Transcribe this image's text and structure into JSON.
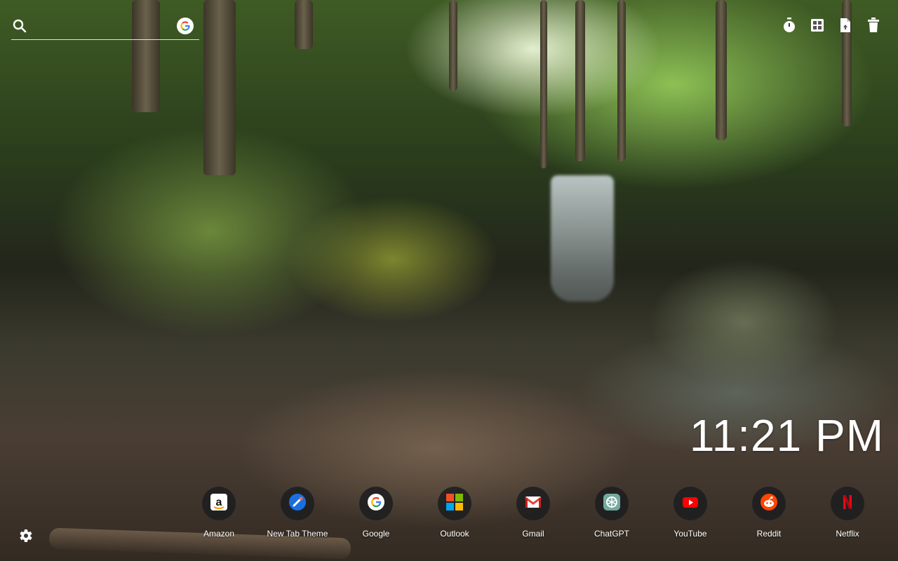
{
  "search": {
    "placeholder": "",
    "icon": "search-icon",
    "engine_icon": "google-icon"
  },
  "toolbar": {
    "items": [
      {
        "icon": "timer-icon"
      },
      {
        "icon": "grid-widget-icon"
      },
      {
        "icon": "file-icon"
      },
      {
        "icon": "trash-icon"
      }
    ]
  },
  "clock": {
    "time": "11:21 PM"
  },
  "shortcuts": [
    {
      "label": "Amazon",
      "icon": "amazon-icon"
    },
    {
      "label": "New Tab Theme",
      "icon": "new-tab-theme-icon"
    },
    {
      "label": "Google",
      "icon": "google-icon"
    },
    {
      "label": "Outlook",
      "icon": "microsoft-icon"
    },
    {
      "label": "Gmail",
      "icon": "gmail-icon"
    },
    {
      "label": "ChatGPT",
      "icon": "chatgpt-icon"
    },
    {
      "label": "YouTube",
      "icon": "youtube-icon"
    },
    {
      "label": "Reddit",
      "icon": "reddit-icon"
    },
    {
      "label": "Netflix",
      "icon": "netflix-icon"
    }
  ],
  "settings": {
    "icon": "gear-icon"
  },
  "colors": {
    "text": "#ffffff",
    "shortcut_bg": "#1e1e20"
  }
}
